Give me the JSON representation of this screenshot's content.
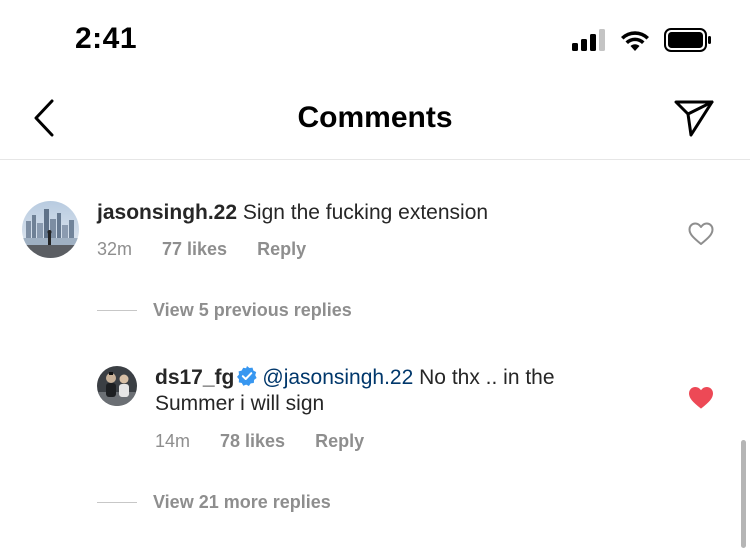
{
  "status_bar": {
    "time": "2:41"
  },
  "header": {
    "title": "Comments"
  },
  "comments": [
    {
      "username": "jasonsingh.22",
      "text": "Sign the fucking extension",
      "time": "32m",
      "likes": "77 likes",
      "reply": "Reply",
      "liked": false
    }
  ],
  "view_previous": "View 5 previous replies",
  "reply": {
    "username": "ds17_fg",
    "verified": true,
    "mention": "@jasonsingh.22",
    "text_line1": "No thx .. in the",
    "text_line2": "Summer i will sign",
    "time": "14m",
    "likes": "78 likes",
    "reply": "Reply",
    "liked": true
  },
  "view_more": "View 21 more replies",
  "colors": {
    "heart_liked": "#ed4956",
    "verified": "#3897f0",
    "mention": "#00376b",
    "meta": "#8e8e8e"
  }
}
